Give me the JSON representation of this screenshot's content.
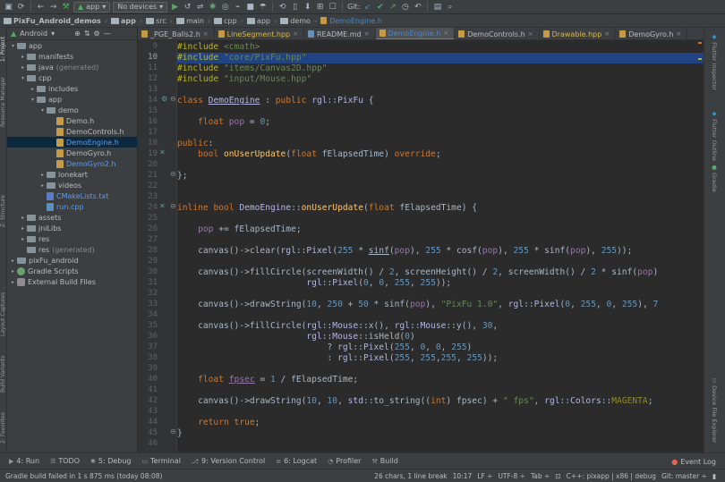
{
  "toolbar": {
    "run_config": "app",
    "device": "No devices",
    "git_label": "Git:"
  },
  "breadcrumb": [
    "PixFu_Android_demos",
    "app",
    "src",
    "main",
    "cpp",
    "app",
    "demo",
    "DemoEngine.h"
  ],
  "project_panel": {
    "view": "Android",
    "tree": [
      {
        "label": "app",
        "indent": 0,
        "arrow": "▾",
        "icon": "folder"
      },
      {
        "label": "manifests",
        "indent": 1,
        "arrow": "▸",
        "icon": "folder"
      },
      {
        "label": "java",
        "suffix": "(generated)",
        "indent": 1,
        "arrow": "▸",
        "icon": "folder"
      },
      {
        "label": "cpp",
        "indent": 1,
        "arrow": "▾",
        "icon": "folder"
      },
      {
        "label": "includes",
        "indent": 2,
        "arrow": "▸",
        "icon": "folder"
      },
      {
        "label": "app",
        "indent": 2,
        "arrow": "▾",
        "icon": "folder"
      },
      {
        "label": "demo",
        "indent": 3,
        "arrow": "▾",
        "icon": "folder"
      },
      {
        "label": "Demo.h",
        "indent": 4,
        "arrow": "",
        "icon": "file"
      },
      {
        "label": "DemoControls.h",
        "indent": 4,
        "arrow": "",
        "icon": "file"
      },
      {
        "label": "DemoEngine.h",
        "indent": 4,
        "arrow": "",
        "icon": "file",
        "selected": true,
        "blue": true
      },
      {
        "label": "DemoGyro.h",
        "indent": 4,
        "arrow": "",
        "icon": "file"
      },
      {
        "label": "DemoGyro2.h",
        "indent": 4,
        "arrow": "",
        "icon": "file",
        "blue": true
      },
      {
        "label": "lonekart",
        "indent": 3,
        "arrow": "▸",
        "icon": "folder"
      },
      {
        "label": "videos",
        "indent": 3,
        "arrow": "▸",
        "icon": "folder"
      },
      {
        "label": "CMakeLists.txt",
        "indent": 3,
        "arrow": "",
        "icon": "cmake",
        "blue": true
      },
      {
        "label": "run.cpp",
        "indent": 3,
        "arrow": "",
        "icon": "cpp",
        "blue": true
      },
      {
        "label": "assets",
        "indent": 1,
        "arrow": "▸",
        "icon": "folder"
      },
      {
        "label": "jniLibs",
        "indent": 1,
        "arrow": "▸",
        "icon": "folder"
      },
      {
        "label": "res",
        "indent": 1,
        "arrow": "▸",
        "icon": "folder"
      },
      {
        "label": "res",
        "suffix": "(generated)",
        "indent": 1,
        "arrow": "",
        "icon": "folder"
      },
      {
        "label": "pixFu_android",
        "indent": 0,
        "arrow": "▸",
        "icon": "folder"
      },
      {
        "label": "Gradle Scripts",
        "indent": 0,
        "arrow": "▸",
        "icon": "gradle"
      },
      {
        "label": "External Build Files",
        "indent": 0,
        "arrow": "▸",
        "icon": "ext"
      }
    ]
  },
  "tabs": [
    {
      "label": "_PGE_Balls2.h",
      "type": "h"
    },
    {
      "label": "LineSegment.hpp",
      "type": "h",
      "yellow": true
    },
    {
      "label": "README.md",
      "type": "md"
    },
    {
      "label": "DemoEngine.h",
      "type": "h",
      "active": true
    },
    {
      "label": "DemoControls.h",
      "type": "h"
    },
    {
      "label": "Drawable.hpp",
      "type": "h",
      "yellow": true
    },
    {
      "label": "DemoGyro.h",
      "type": "h"
    }
  ],
  "editor": {
    "lines": [
      {
        "n": "9",
        "html": "<span class=\"pp\">#include</span> <span class=\"str\">&lt;cmath&gt;</span>"
      },
      {
        "n": "10",
        "html": "<span class=\"pp\">#include</span> <span class=\"str\">\"core/PixFu.hpp\"</span>",
        "current": true
      },
      {
        "n": "11",
        "html": "<span class=\"pp\">#include</span> <span class=\"str\">\"items/Canvas2D.hpp\"</span>"
      },
      {
        "n": "12",
        "html": "<span class=\"pp\">#include</span> <span class=\"str\">\"input/Mouse.hpp\"</span>"
      },
      {
        "n": "13",
        "html": ""
      },
      {
        "n": "14",
        "html": "<span class=\"kw\">class</span> <span class=\"cls-u\">DemoEngine</span> : <span class=\"kw\">public</span> <span class=\"cls\">rgl</span>::<span class=\"cls\">PixFu</span> {"
      },
      {
        "n": "15",
        "html": ""
      },
      {
        "n": "16",
        "html": "    <span class=\"kw\">float</span> <span class=\"var\">pop</span> = <span class=\"num\">0</span>;"
      },
      {
        "n": "17",
        "html": ""
      },
      {
        "n": "18",
        "html": "<span class=\"kw\">public</span>:"
      },
      {
        "n": "19",
        "html": "    <span class=\"kw\">bool</span> <span class=\"fn\">onUserUpdate</span>(<span class=\"kw\">float</span> fElapsedTime) <span class=\"kw\">override</span>;"
      },
      {
        "n": "20",
        "html": ""
      },
      {
        "n": "21",
        "html": "};"
      },
      {
        "n": "22",
        "html": ""
      },
      {
        "n": "23",
        "html": ""
      },
      {
        "n": "24",
        "html": "<span class=\"kw\">inline</span> <span class=\"kw\">bool</span> <span class=\"cls\">DemoEngine</span>::<span class=\"fn\">onUserUpdate</span>(<span class=\"kw\">float</span> fElapsedTime) {"
      },
      {
        "n": "25",
        "html": ""
      },
      {
        "n": "26",
        "html": "    <span class=\"var\">pop</span> += fElapsedTime;"
      },
      {
        "n": "27",
        "html": ""
      },
      {
        "n": "28",
        "html": "    canvas()-&gt;clear(<span class=\"cls\">rgl</span>::<span class=\"cls\">Pixel</span>(<span class=\"num\">255</span> * <span class=\"sinf-u\">sinf</span>(<span class=\"var\">pop</span>), <span class=\"num\">255</span> * cosf(<span class=\"var\">pop</span>), <span class=\"num\">255</span> * sinf(<span class=\"var\">pop</span>), <span class=\"num\">255</span>));"
      },
      {
        "n": "29",
        "html": ""
      },
      {
        "n": "30",
        "html": "    canvas()-&gt;fillCircle(screenWidth() / <span class=\"num\">2</span>, screenHeight() / <span class=\"num\">2</span>, screenWidth() / <span class=\"num\">2</span> * sinf(<span class=\"var\">pop</span>)"
      },
      {
        "n": "31",
        "html": "                         <span class=\"cls\">rgl</span>::<span class=\"cls\">Pixel</span>(<span class=\"num\">0</span>, <span class=\"num\">0</span>, <span class=\"num\">255</span>, <span class=\"num\">255</span>));"
      },
      {
        "n": "32",
        "html": ""
      },
      {
        "n": "33",
        "html": "    canvas()-&gt;drawString(<span class=\"num\">10</span>, <span class=\"num\">250</span> + <span class=\"num\">50</span> * sinf(<span class=\"var\">pop</span>), <span class=\"str\">\"PixFu 1.0\"</span>, <span class=\"cls\">rgl</span>::<span class=\"cls\">Pixel</span>(<span class=\"num\">0</span>, <span class=\"num\">255</span>, <span class=\"num\">0</span>, <span class=\"num\">255</span>), <span class=\"num\">7</span>"
      },
      {
        "n": "34",
        "html": ""
      },
      {
        "n": "35",
        "html": "    canvas()-&gt;fillCircle(<span class=\"cls\">rgl</span>::<span class=\"cls\">Mouse</span>::x(), <span class=\"cls\">rgl</span>::<span class=\"cls\">Mouse</span>::y(), <span class=\"num\">30</span>,"
      },
      {
        "n": "36",
        "html": "                         <span class=\"cls\">rgl</span>::<span class=\"cls\">Mouse</span>::isHeld(<span class=\"num\">0</span>)"
      },
      {
        "n": "37",
        "html": "                             ? <span class=\"cls\">rgl</span>::<span class=\"cls\">Pixel</span>(<span class=\"num\">255</span>, <span class=\"num\">0</span>, <span class=\"num\">0</span>, <span class=\"num\">255</span>)"
      },
      {
        "n": "38",
        "html": "                             : <span class=\"cls\">rgl</span>::<span class=\"cls\">Pixel</span>(<span class=\"num\">255</span>, <span class=\"num\">255</span>,<span class=\"num\">255</span>, <span class=\"num\">255</span>));"
      },
      {
        "n": "39",
        "html": ""
      },
      {
        "n": "40",
        "html": "    <span class=\"kw\">float</span> <span class=\"var-u\">fpsec</span> = <span class=\"num\">1</span> / fElapsedTime;"
      },
      {
        "n": "41",
        "html": ""
      },
      {
        "n": "42",
        "html": "    canvas()-&gt;drawString(<span class=\"num\">10</span>, <span class=\"num\">10</span>, <span class=\"cls\">std</span>::to_string((<span class=\"kw\">int</span>) fpsec) + <span class=\"str\">\" fps\"</span>, <span class=\"cls\">rgl</span>::<span class=\"cls\">Colors</span>::<span class=\"macro\">MAGENTA</span>;"
      },
      {
        "n": "43",
        "html": ""
      },
      {
        "n": "44",
        "html": "    <span class=\"kw\">return true</span>;"
      },
      {
        "n": "45",
        "html": "}"
      },
      {
        "n": "46",
        "html": ""
      }
    ]
  },
  "right_tools": [
    "Flutter Inspector",
    "Flutter Outline",
    "Gradle",
    "Device File Explorer"
  ],
  "left_tools": [
    "1: Project",
    "Resource Manager",
    "Z: Structure",
    "Layout Captures",
    "Build Variants",
    "2: Favorites"
  ],
  "bottom_tools": [
    {
      "label": "4: Run",
      "icon": "▶"
    },
    {
      "label": "TODO",
      "icon": "☰"
    },
    {
      "label": "5: Debug",
      "icon": "✱"
    },
    {
      "label": "Terminal",
      "icon": "▭"
    },
    {
      "label": "9: Version Control",
      "icon": "⎇"
    },
    {
      "label": "6: Logcat",
      "icon": "≡"
    },
    {
      "label": "Profiler",
      "icon": "◔"
    },
    {
      "label": "Build",
      "icon": "⚒"
    }
  ],
  "event_log": "Event Log",
  "status": {
    "message": "Gradle build failed in 1 s 875 ms (today 08:08)",
    "chars": "26 chars, 1 line break",
    "pos": "10:17",
    "lf": "LF ÷",
    "encoding": "UTF-8 ÷",
    "tab": "Tab ÷",
    "context": "C++: pixapp | x86 | debug",
    "git": "Git: master ÷"
  }
}
